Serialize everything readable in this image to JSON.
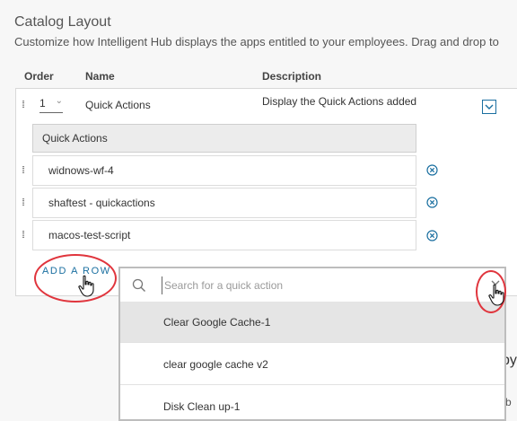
{
  "page": {
    "title": "Catalog Layout",
    "description": "Customize how Intelligent Hub displays the apps entitled to your employees. Drag and drop to"
  },
  "table": {
    "headers": {
      "order": "Order",
      "name": "Name",
      "description": "Description"
    },
    "row": {
      "order": "1",
      "name": "Quick Actions",
      "description": "Display the Quick Actions added"
    }
  },
  "quick_actions": {
    "header": "Quick Actions",
    "items": [
      {
        "label": "widnows-wf-4"
      },
      {
        "label": "shaftest - quickactions"
      },
      {
        "label": "macos-test-script"
      }
    ],
    "add_row_label": "ADD A ROW"
  },
  "dropdown": {
    "search_placeholder": "Search for a quick action",
    "options": [
      {
        "label": "Clear Google Cache-1",
        "highlighted": true
      },
      {
        "label": "clear google cache v2",
        "highlighted": false
      },
      {
        "label": "Disk Clean up-1",
        "highlighted": false
      }
    ]
  },
  "behind": {
    "text_1": "py",
    "text_2": "b"
  },
  "colors": {
    "accent": "#1a6fa0",
    "annotation": "#e0353d",
    "highlight_bg": "#e5e5e5"
  }
}
